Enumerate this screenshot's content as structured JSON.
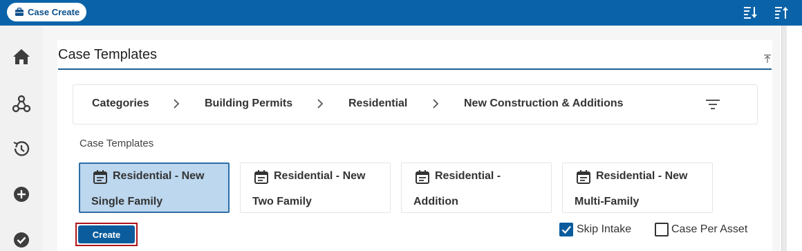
{
  "header": {
    "app_button_label": "Case Create",
    "app_button_icon": "briefcase-icon",
    "right_icons": [
      "sort-descending-icon",
      "sort-ascending-icon"
    ]
  },
  "sidebar": {
    "icons": [
      "home-icon",
      "network-icon",
      "history-icon",
      "add-circle-icon",
      "check-circle-icon"
    ]
  },
  "panel": {
    "title": "Case Templates"
  },
  "breadcrumb": {
    "items": [
      "Categories",
      "Building Permits",
      "Residential",
      "New Construction & Additions"
    ]
  },
  "templates": {
    "label": "Case Templates",
    "cards": [
      {
        "line1": "Residential - New",
        "line2": "Single Family",
        "selected": true
      },
      {
        "line1": "Residential - New",
        "line2": "Two Family",
        "selected": false
      },
      {
        "line1": "Residential -",
        "line2": "Addition",
        "selected": false
      },
      {
        "line1": "Residential - New",
        "line2": "Multi-Family",
        "selected": false
      }
    ]
  },
  "actions": {
    "create_label": "Create",
    "skip_intake_label": "Skip Intake",
    "skip_intake_checked": true,
    "case_per_asset_label": "Case Per Asset",
    "case_per_asset_checked": false
  },
  "colors": {
    "header": "#0a63a8",
    "accent": "#0a5c9d",
    "selected_card": "#bcd7ee",
    "highlight_outline": "#b0151a"
  }
}
